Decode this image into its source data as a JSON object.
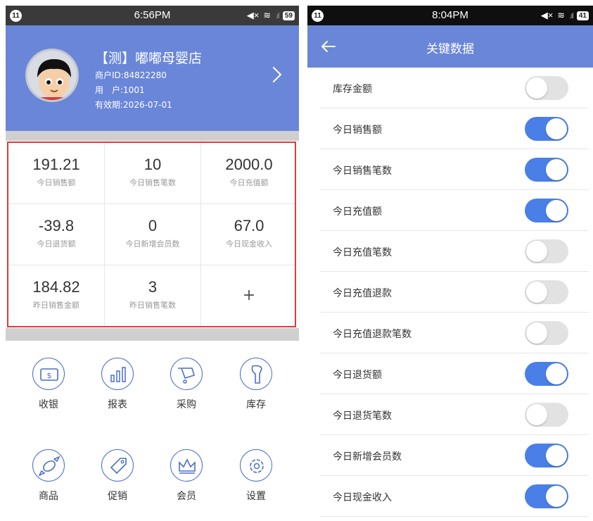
{
  "left": {
    "status": {
      "badge": "11",
      "time": "6:56PM",
      "battery": "59"
    },
    "profile": {
      "shop_name": "【测】嘟嘟母婴店",
      "merchant_id": "商户ID:84822280",
      "user": "用　户:1001",
      "valid_until": "有效期:2026-07-01"
    },
    "stats": [
      {
        "value": "191.21",
        "label": "今日销售额"
      },
      {
        "value": "10",
        "label": "今日销售笔数"
      },
      {
        "value": "2000.0",
        "label": "今日充值额"
      },
      {
        "value": "-39.8",
        "label": "今日退货额"
      },
      {
        "value": "0",
        "label": "今日新增会员数"
      },
      {
        "value": "67.0",
        "label": "今日现金收入"
      },
      {
        "value": "184.82",
        "label": "昨日销售金额"
      },
      {
        "value": "3",
        "label": "昨日销售笔数"
      }
    ],
    "add_label": "+",
    "menu": [
      {
        "label": "收银",
        "icon": "cash-icon"
      },
      {
        "label": "报表",
        "icon": "report-icon"
      },
      {
        "label": "采购",
        "icon": "cart-icon"
      },
      {
        "label": "库存",
        "icon": "scanner-icon"
      },
      {
        "label": "商品",
        "icon": "candy-icon"
      },
      {
        "label": "促销",
        "icon": "tag-icon"
      },
      {
        "label": "会员",
        "icon": "crown-icon"
      },
      {
        "label": "设置",
        "icon": "gear-icon"
      }
    ]
  },
  "right": {
    "status": {
      "badge": "11",
      "time": "8:04PM",
      "battery": "41"
    },
    "title": "关键数据",
    "rows": [
      {
        "label": "库存金额",
        "on": false
      },
      {
        "label": "今日销售额",
        "on": true
      },
      {
        "label": "今日销售笔数",
        "on": true
      },
      {
        "label": "今日充值额",
        "on": true
      },
      {
        "label": "今日充值笔数",
        "on": false
      },
      {
        "label": "今日充值退款",
        "on": false
      },
      {
        "label": "今日充值退款笔数",
        "on": false
      },
      {
        "label": "今日退货额",
        "on": true
      },
      {
        "label": "今日退货笔数",
        "on": false
      },
      {
        "label": "今日新增会员数",
        "on": true
      },
      {
        "label": "今日现金收入",
        "on": true
      }
    ]
  },
  "colors": {
    "header": "#6a86d9",
    "toggle_on": "#4a7fe8",
    "highlight_border": "#e03a3a"
  }
}
